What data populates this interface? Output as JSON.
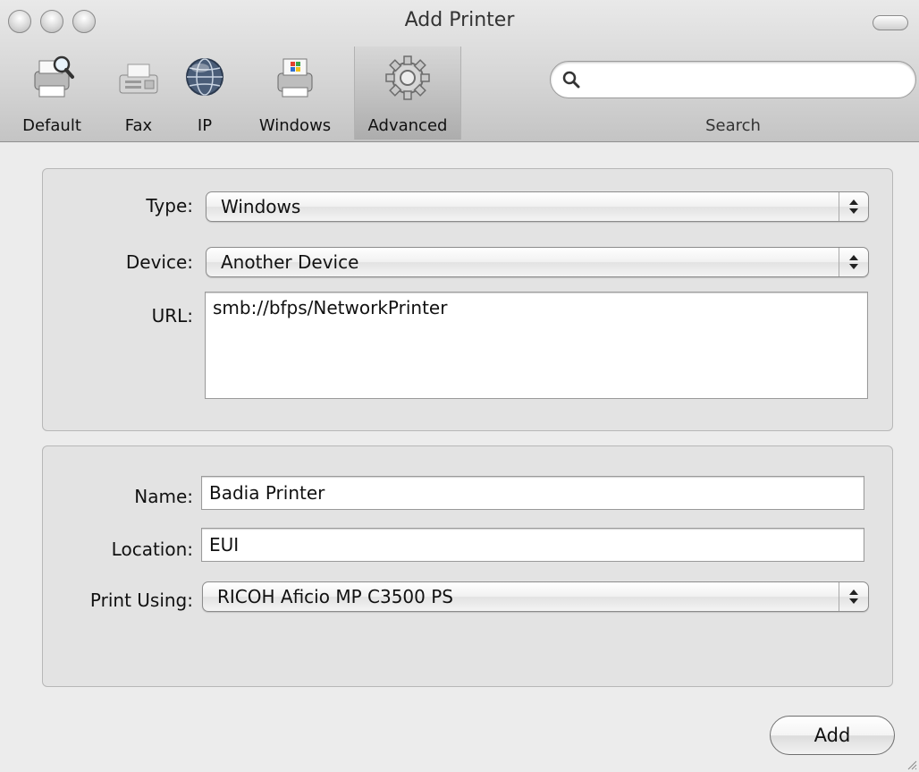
{
  "window": {
    "title": "Add Printer"
  },
  "toolbar": {
    "items": [
      {
        "label": "Default",
        "icon": "printer-magnifier-icon"
      },
      {
        "label": "Fax",
        "icon": "fax-icon"
      },
      {
        "label": "IP",
        "icon": "globe-icon"
      },
      {
        "label": "Windows",
        "icon": "windows-printer-icon"
      },
      {
        "label": "Advanced",
        "icon": "gear-icon",
        "selected": true
      }
    ],
    "search": {
      "label": "Search",
      "value": "",
      "placeholder": ""
    }
  },
  "device_group": {
    "type": {
      "label": "Type:",
      "value": "Windows"
    },
    "device": {
      "label": "Device:",
      "value": "Another Device"
    },
    "url": {
      "label": "URL:",
      "value": "smb://bfps/NetworkPrinter"
    }
  },
  "printer_group": {
    "name": {
      "label": "Name:",
      "value": "Badia Printer"
    },
    "location": {
      "label": "Location:",
      "value": "EUI"
    },
    "print_using": {
      "label": "Print Using:",
      "value": "RICOH Aficio MP C3500 PS"
    }
  },
  "buttons": {
    "add_label": "Add"
  },
  "colors": {
    "window_bg": "#ececec",
    "group_bg": "#e3e3e3"
  }
}
